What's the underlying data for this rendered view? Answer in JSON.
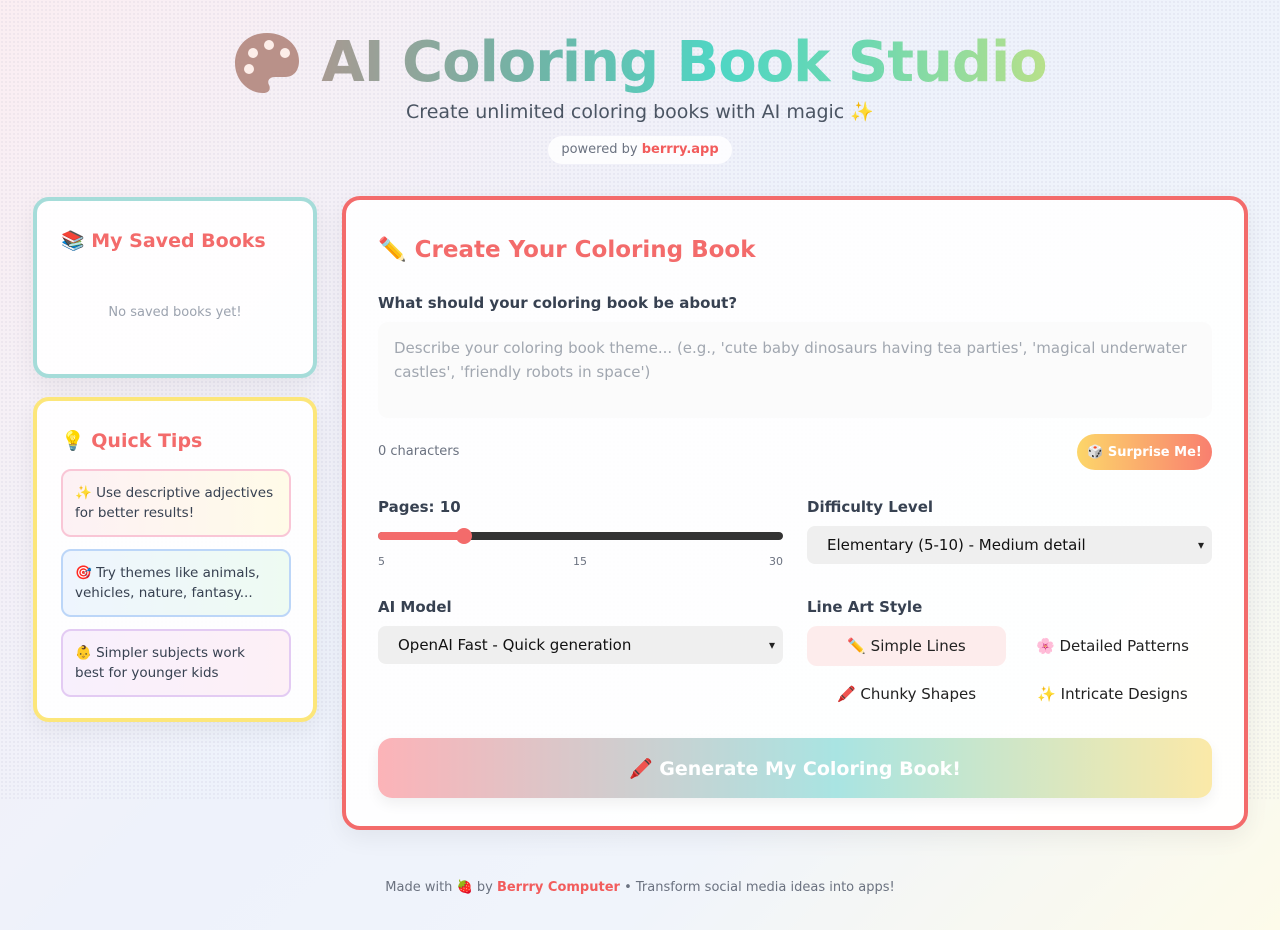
{
  "header": {
    "title": "AI Coloring Book Studio",
    "subtitle": "Create unlimited coloring books with AI magic ✨",
    "powered_prefix": "powered by",
    "powered_brand": "berrry.app",
    "logo_icon": "palette-icon"
  },
  "saved_books": {
    "title": "📚 My Saved Books",
    "empty_message": "No saved books yet!"
  },
  "quick_tips": {
    "title": "💡 Quick Tips",
    "tips": [
      "✨ Use descriptive adjectives for better results!",
      "🎯 Try themes like animals, vehicles, nature, fantasy...",
      "👶 Simpler subjects work best for younger kids"
    ]
  },
  "create": {
    "title": "✏️ Create Your Coloring Book",
    "prompt_label": "What should your coloring book be about?",
    "prompt_placeholder": "Describe your coloring book theme... (e.g., 'cute baby dinosaurs having tea parties', 'magical underwater castles', 'friendly robots in space')",
    "prompt_value": "",
    "char_count": "0 characters",
    "surprise_label": "🎲 Surprise Me!",
    "pages_label": "Pages: 10",
    "pages": {
      "min": 5,
      "max": 30,
      "value": 10,
      "tick_labels": [
        "5",
        "15",
        "30"
      ]
    },
    "difficulty_label": "Difficulty Level",
    "difficulty_selected": "Elementary (5-10) - Medium detail",
    "model_label": "AI Model",
    "model_selected": "OpenAI Fast - Quick generation",
    "style_label": "Line Art Style",
    "styles": [
      {
        "label": "✏️ Simple Lines",
        "active": true
      },
      {
        "label": "🌸 Detailed Patterns",
        "active": false
      },
      {
        "label": "🖍️ Chunky Shapes",
        "active": false
      },
      {
        "label": "✨ Intricate Designs",
        "active": false
      }
    ],
    "generate_label": "🖍️ Generate My Coloring Book!"
  },
  "footer": {
    "prefix": "Made with 🍓 by",
    "brand": "Berrry Computer",
    "suffix": "• Transform social media ideas into apps!"
  },
  "colors": {
    "accent": "#f36b6b",
    "saved_border": "#a5dcd9",
    "tips_border": "#fce67a"
  }
}
